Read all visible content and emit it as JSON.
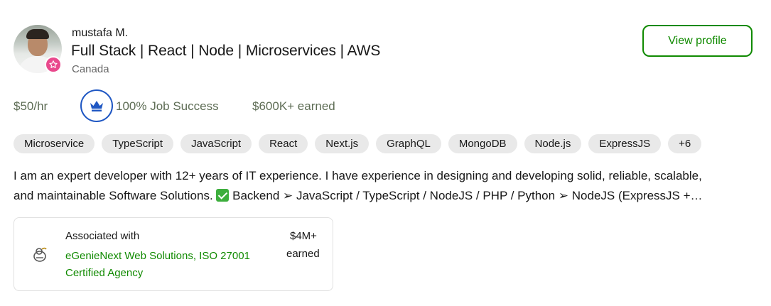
{
  "profile": {
    "name": "mustafa M.",
    "title": "Full Stack | React | Node | Microservices | AWS",
    "location": "Canada",
    "view_profile_label": "View profile",
    "badge_icon": "star-badge-icon",
    "badge_color": "#e9498d"
  },
  "stats": {
    "rate": "$50/hr",
    "job_success": "100% Job Success",
    "earned": "$600K+ earned",
    "crown_icon": "crown-icon",
    "crown_color": "#1f57c3"
  },
  "skills": [
    "Microservice",
    "TypeScript",
    "JavaScript",
    "React",
    "Next.js",
    "GraphQL",
    "MongoDB",
    "Node.js",
    "ExpressJS",
    "+6"
  ],
  "description": {
    "line1": "I am an expert developer with 12+ years of IT experience. I have experience in designing and developing solid, reliable, scalable,",
    "line2_before": "and maintainable Software Solutions. ",
    "line2_after": " Backend ➢ JavaScript / TypeScript / NodeJS / PHP / Python ➢ NodeJS (ExpressJS +…"
  },
  "agency": {
    "associated_label": "Associated with",
    "name": "eGenieNext Web Solutions, ISO 27001 Certified Agency",
    "earnings_amount": "$4M+",
    "earnings_label": "earned",
    "logo_icon": "agency-logo-icon"
  },
  "colors": {
    "accent_green": "#108a00",
    "text": "#181818",
    "muted": "#676767"
  }
}
